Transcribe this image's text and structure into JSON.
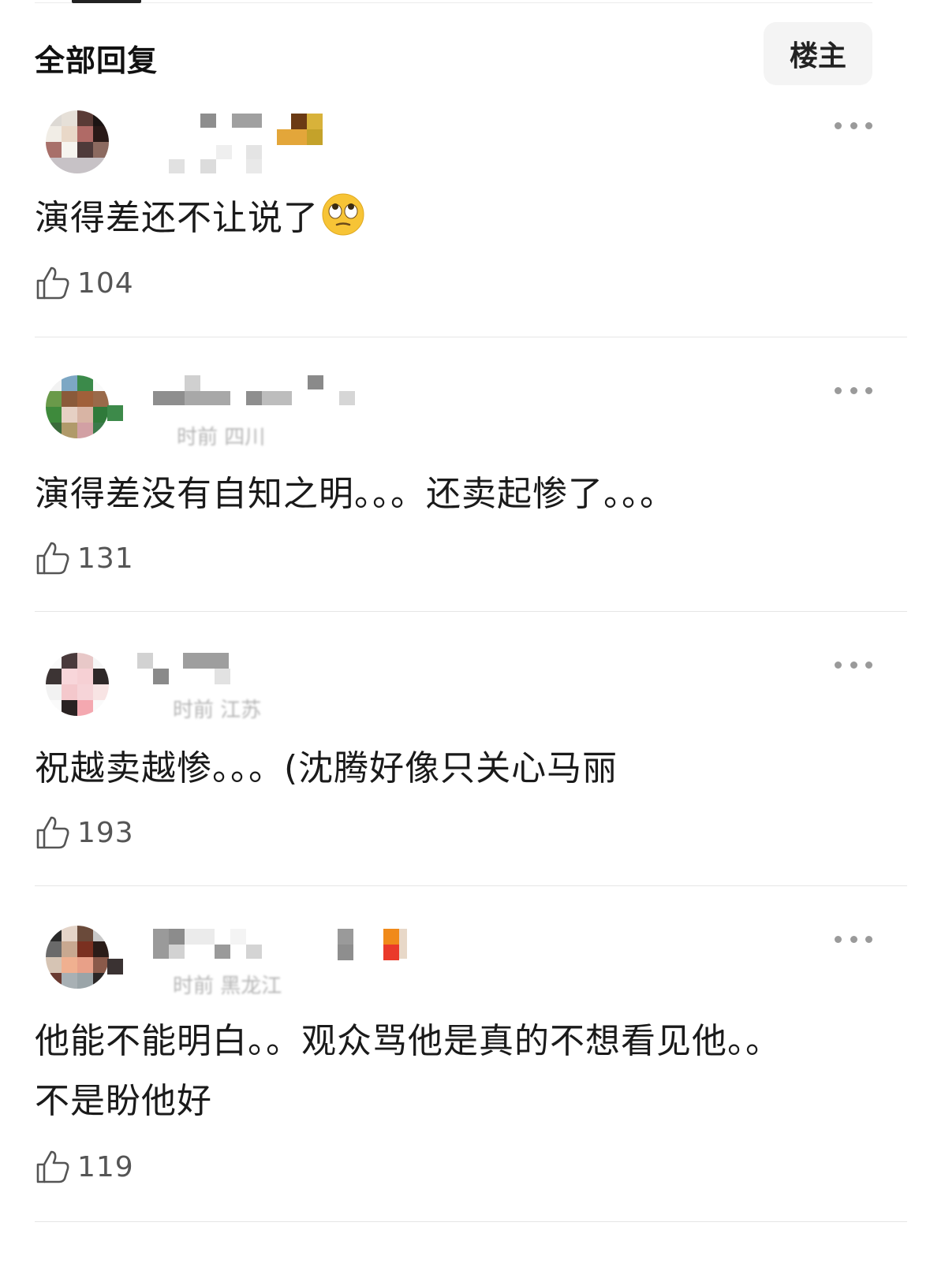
{
  "header": {
    "title": "全部回复",
    "filter_label": "楼主"
  },
  "icons": {
    "more": "more-horizontal-icon",
    "like": "thumbs-up-icon",
    "emoji": "face-with-rolling-eyes-emoji"
  },
  "comments": [
    {
      "text": "演得差还不让说了",
      "likes": "104",
      "meta": ""
    },
    {
      "text": "演得差没有自知之明。。。还卖起惨了。。。",
      "likes": "131",
      "meta": "时前 四川"
    },
    {
      "text": "祝越卖越惨。。。(沈腾好像只关心马丽",
      "likes": "193",
      "meta": "时前 江苏"
    },
    {
      "text_lines": [
        "他能不能明白。。观众骂他是真的不想看见他。。",
        "不是盼他好"
      ],
      "likes": "119",
      "meta": "时前 黑龙江"
    }
  ]
}
